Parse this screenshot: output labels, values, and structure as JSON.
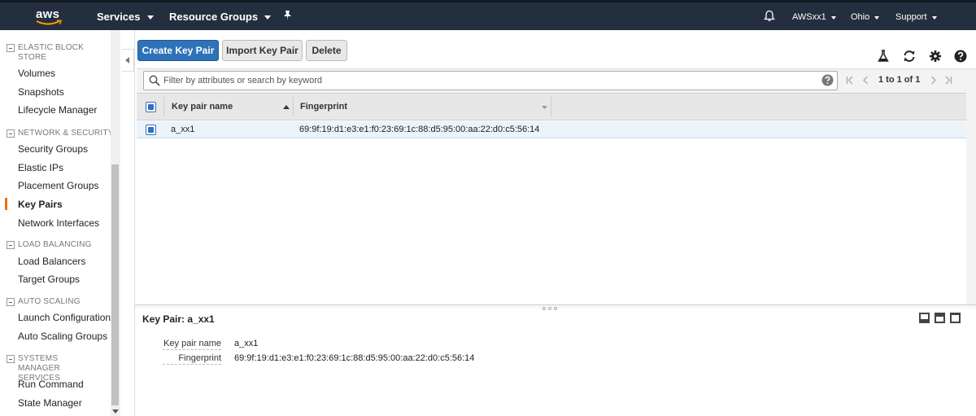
{
  "topnav": {
    "logo_text": "aws",
    "services": "Services",
    "resource_groups": "Resource Groups",
    "account": "AWSxx1",
    "region": "Ohio",
    "support": "Support"
  },
  "sidebar": {
    "sections": [
      {
        "title": "ELASTIC BLOCK STORE",
        "items": [
          "Volumes",
          "Snapshots",
          "Lifecycle Manager"
        ]
      },
      {
        "title": "NETWORK & SECURITY",
        "items": [
          "Security Groups",
          "Elastic IPs",
          "Placement Groups",
          "Key Pairs",
          "Network Interfaces"
        ]
      },
      {
        "title": "LOAD BALANCING",
        "items": [
          "Load Balancers",
          "Target Groups"
        ]
      },
      {
        "title": "AUTO SCALING",
        "items": [
          "Launch Configurations",
          "Auto Scaling Groups"
        ]
      },
      {
        "title": "SYSTEMS MANAGER SERVICES",
        "items": [
          "Run Command",
          "State Manager"
        ]
      }
    ],
    "active_item": "Key Pairs"
  },
  "toolbar": {
    "create_label": "Create Key Pair",
    "import_label": "Import Key Pair",
    "delete_label": "Delete"
  },
  "filter": {
    "placeholder": "Filter by attributes or search by keyword",
    "pager_text": "1 to 1 of 1"
  },
  "table": {
    "columns": [
      "Key pair name",
      "Fingerprint"
    ],
    "rows": [
      {
        "name": "a_xx1",
        "fingerprint": "69:9f:19:d1:e3:e1:f0:23:69:1c:88:d5:95:00:aa:22:d0:c5:56:14"
      }
    ]
  },
  "detail": {
    "title": "Key Pair: a_xx1",
    "fields": [
      {
        "label": "Key pair name",
        "value": "a_xx1"
      },
      {
        "label": "Fingerprint",
        "value": "69:9f:19:d1:e3:e1:f0:23:69:1c:88:d5:95:00:aa:22:d0:c5:56:14"
      }
    ]
  },
  "colors": {
    "nav_bg": "#232f3e",
    "primary_button": "#2e73b8",
    "active_accent": "#ec7211",
    "selected_row": "#ebf3fb"
  }
}
